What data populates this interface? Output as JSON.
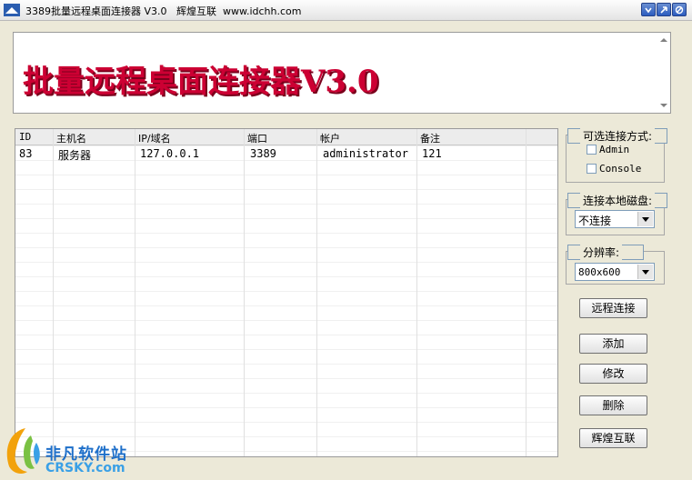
{
  "window": {
    "title": "3389批量远程桌面连接器 V3.0   辉煌互联  www.idchh.com"
  },
  "banner": {
    "title": "批量远程桌面连接器V3.0"
  },
  "table": {
    "columns": [
      "ID",
      "主机名",
      "IP/域名",
      "端口",
      "帐户",
      "备注"
    ],
    "rows": [
      {
        "id": "83",
        "host": "服务器",
        "ip": "127.0.0.1",
        "port": "3389",
        "account": "administrator",
        "note": "121"
      }
    ]
  },
  "options": {
    "connect_mode": {
      "legend": "可选连接方式:",
      "admin_label": "Admin",
      "console_label": "Console"
    },
    "local_disk": {
      "legend": "连接本地磁盘:",
      "value": "不连接"
    },
    "resolution": {
      "legend": "分辨率:",
      "value": "800x600"
    }
  },
  "buttons": {
    "remote_connect": "远程连接",
    "add": "添加",
    "modify": "修改",
    "delete": "删除",
    "huihuang": "辉煌互联"
  },
  "watermark": {
    "line1": "非凡软件站",
    "line2": "CRSKY.com"
  },
  "colors": {
    "banner_text": "#cc0033",
    "watermark_blue": "#1e6fc9"
  }
}
